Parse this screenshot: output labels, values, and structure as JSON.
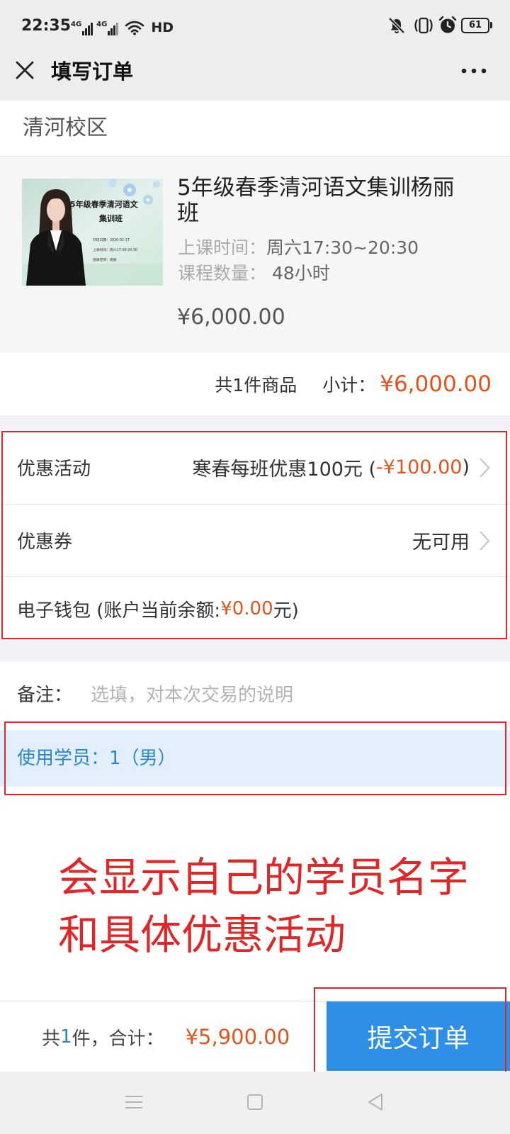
{
  "status_bar": {
    "time": "22:35",
    "net_1": "4G",
    "net_2": "4G",
    "hd": "HD",
    "battery": "61",
    "icons": [
      "signal-icon",
      "signal-icon",
      "wifi-icon",
      "mute-icon",
      "vibrate-icon",
      "alarm-icon",
      "battery-icon"
    ]
  },
  "header": {
    "title": "填写订单",
    "icons": [
      "close-icon",
      "more-icon"
    ]
  },
  "campus": {
    "name": "清河校区"
  },
  "course": {
    "poster": {
      "title_line1": "5年级春季清河语文",
      "title_line2": "集训班",
      "info": [
        "开班日期：2020-02-17",
        "上课时间：周六17:30-20:30",
        "授课老师：杨丽"
      ]
    },
    "title": "5年级春季清河语文集训杨丽班",
    "schedule_label": "上课时间：",
    "schedule_value": "周六17:30~20:30",
    "count_label": "课程数量：",
    "count_value": " 48小时",
    "price": "¥6,000.00"
  },
  "summary": {
    "items": "共1件商品",
    "subtotal_label": "小计：",
    "subtotal": "¥6,000.00"
  },
  "promotion": {
    "label": "优惠活动",
    "name": "寒春每班优惠100元 (",
    "discount": "-¥100.00",
    "close": ")"
  },
  "coupon": {
    "label": "优惠券",
    "value": "无可用"
  },
  "wallet": {
    "label": "电子钱包",
    "note_prefix": " (账户当前余额:",
    "balance": "¥0.00",
    "note_suffix": "元)"
  },
  "remark": {
    "label": "备注：",
    "placeholder": "选填，对本次交易的说明"
  },
  "student": {
    "label": "使用学员：",
    "value": "1（男）"
  },
  "annotation": {
    "line1": "会显示自己的学员名字",
    "line2": "和具体优惠活动"
  },
  "footer": {
    "prefix": "共",
    "count": "1",
    "suffix": "件，合计：",
    "total": "¥5,900.00",
    "submit_label": "提交订单"
  },
  "nav_bar": {
    "icons": [
      "menu-icon",
      "home-icon",
      "back-icon"
    ]
  },
  "colors": {
    "price": "#e2541e",
    "button_blue": "#2e8fe6",
    "link_blue": "#2a86d5",
    "annotation_red": "#e02626",
    "bar_gray": "#ededed",
    "student_row_bg": "#e3f0fb"
  }
}
